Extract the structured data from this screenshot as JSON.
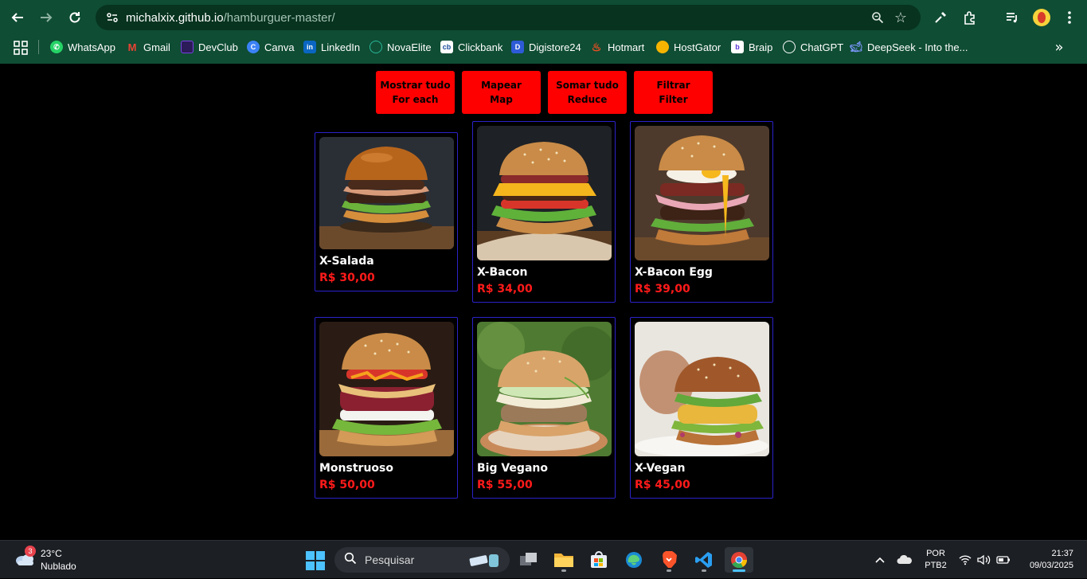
{
  "browser": {
    "url_host": "michalxix.github.io",
    "url_path": "/hamburguer-master/",
    "bookmarks": [
      {
        "label": "WhatsApp",
        "icon": "whatsapp-icon",
        "color": "#25d366"
      },
      {
        "label": "Gmail",
        "icon": "gmail-icon",
        "color": "#ea4335"
      },
      {
        "label": "DevClub",
        "icon": "devclub-icon",
        "color": "#7b3fe4"
      },
      {
        "label": "Canva",
        "icon": "canva-icon",
        "color": "#3b82f6"
      },
      {
        "label": "LinkedIn",
        "icon": "linkedin-icon",
        "color": "#0a66c2"
      },
      {
        "label": "NovaElite",
        "icon": "novaelite-icon",
        "color": "#0f7a6a"
      },
      {
        "label": "Clickbank",
        "icon": "clickbank-icon",
        "color": "#1c4c9c"
      },
      {
        "label": "Digistore24",
        "icon": "digistore-icon",
        "color": "#2d5bd7"
      },
      {
        "label": "Hotmart",
        "icon": "hotmart-icon",
        "color": "#f04e23"
      },
      {
        "label": "HostGator",
        "icon": "hostgator-icon",
        "color": "#f5b400"
      },
      {
        "label": "Braip",
        "icon": "braip-icon",
        "color": "#ffffff"
      },
      {
        "label": "ChatGPT",
        "icon": "chatgpt-icon",
        "color": "#ffffff"
      },
      {
        "label": "DeepSeek - Into the...",
        "icon": "deepseek-icon",
        "color": "#4d6bfe"
      }
    ]
  },
  "menu": {
    "buttons": [
      {
        "line1": "Mostrar tudo",
        "line2": "For each"
      },
      {
        "line1": "Mapear",
        "line2": "Map"
      },
      {
        "line1": "Somar tudo",
        "line2": "Reduce"
      },
      {
        "line1": "Filtrar",
        "line2": "Filter"
      }
    ]
  },
  "products": [
    {
      "name": "X-Salada",
      "price": "R$ 30,00"
    },
    {
      "name": "X-Bacon",
      "price": "R$ 34,00"
    },
    {
      "name": "X-Bacon Egg",
      "price": "R$ 39,00"
    },
    {
      "name": "Monstruoso",
      "price": "R$ 50,00"
    },
    {
      "name": "Big Vegano",
      "price": "R$ 55,00"
    },
    {
      "name": "X-Vegan",
      "price": "R$ 45,00"
    }
  ],
  "taskbar": {
    "weather_badge": "3",
    "weather_temp": "23°C",
    "weather_desc": "Nublado",
    "search_placeholder": "Pesquisar",
    "lang_line1": "POR",
    "lang_line2": "PTB2",
    "time": "21:37",
    "date": "09/03/2025"
  },
  "colors": {
    "accent_red": "#ff0000",
    "card_border": "#2b22c9",
    "chrome_green": "#0f4d34"
  }
}
